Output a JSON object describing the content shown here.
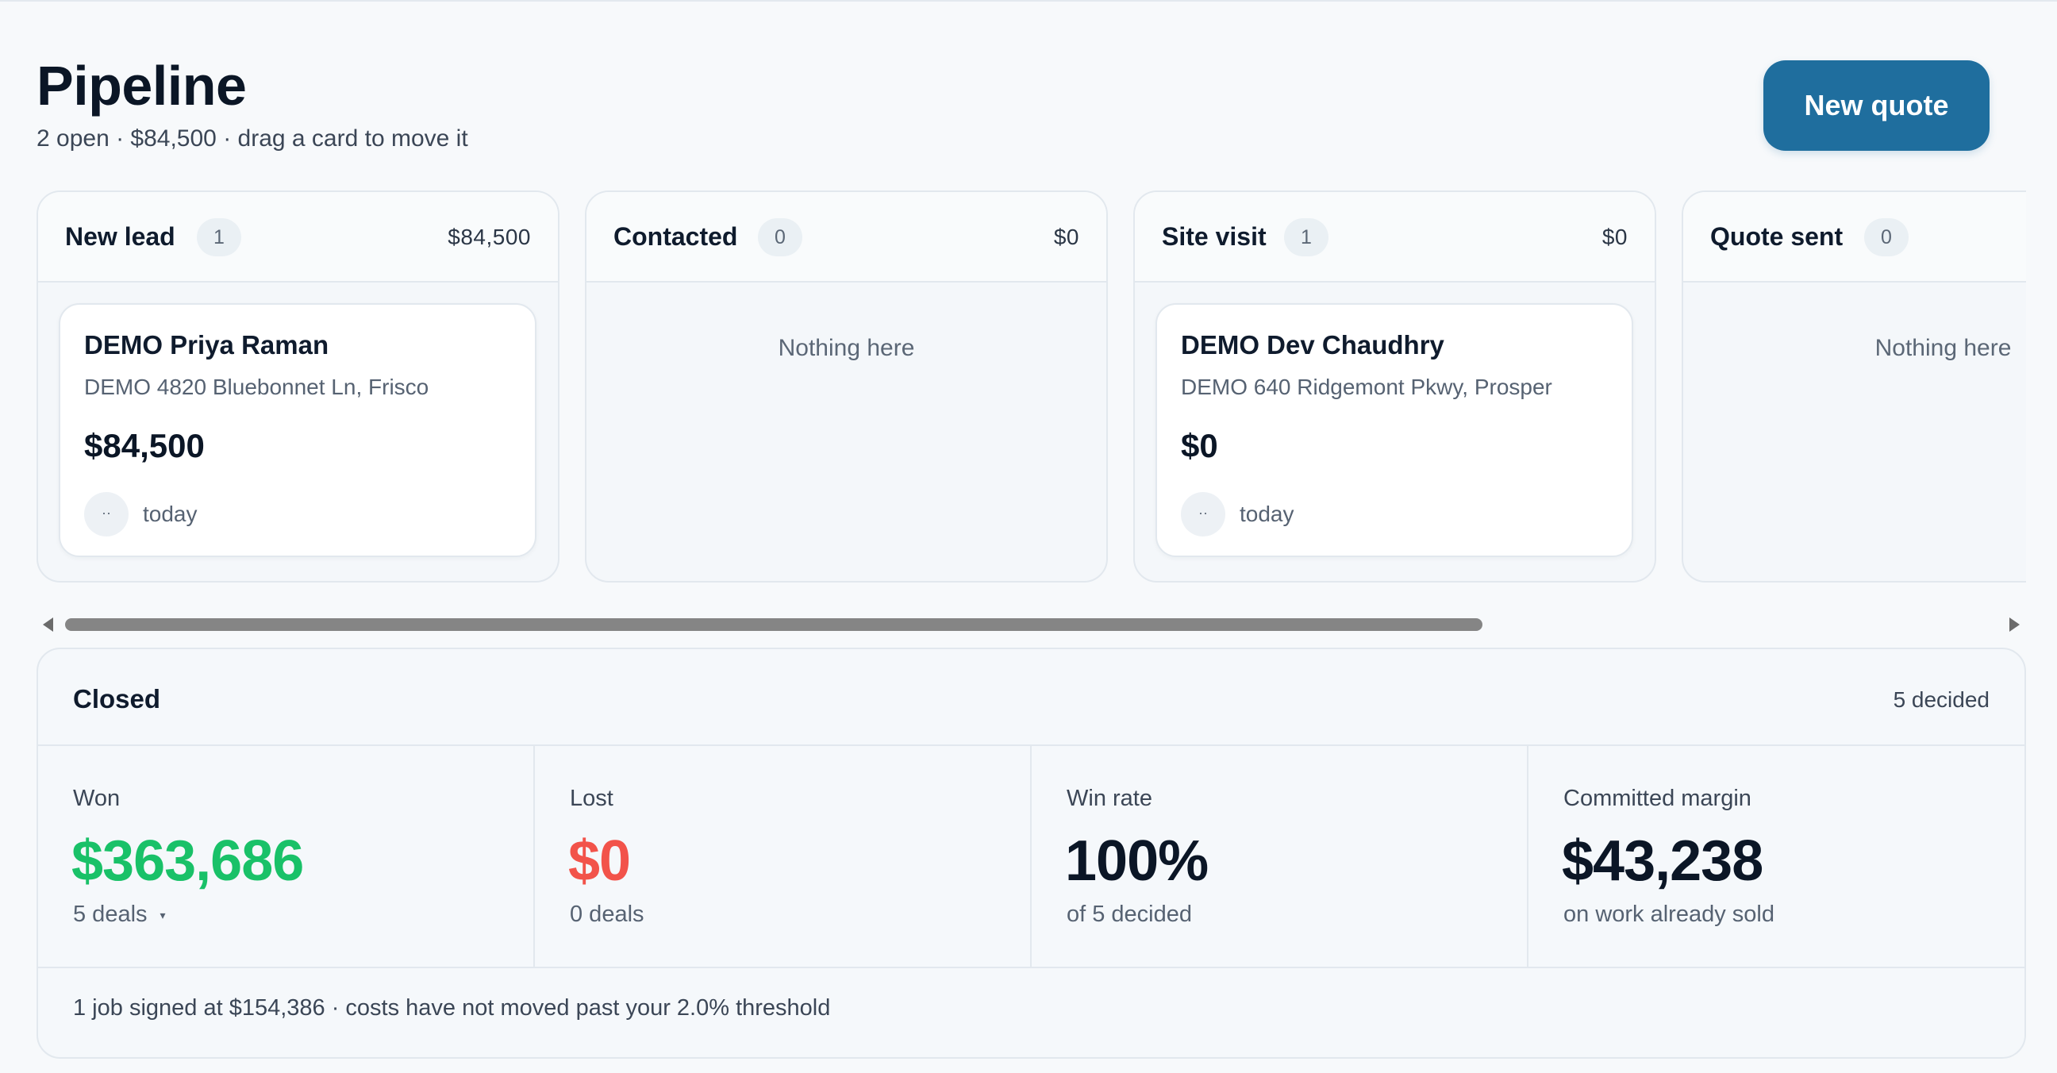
{
  "header": {
    "title": "Pipeline",
    "subtitle": "2 open · $84,500 · drag a card to move it",
    "new_quote_label": "New quote"
  },
  "colors": {
    "primary": "#1f6e9e",
    "won": "#19c168",
    "lost": "#f2534a"
  },
  "columns": [
    {
      "title": "New lead",
      "count": "1",
      "total": "$84,500",
      "card": {
        "name": "DEMO Priya Raman",
        "address": "DEMO 4820 Bluebonnet Ln, Frisco",
        "amount": "$84,500",
        "avatar": "··",
        "date": "today"
      }
    },
    {
      "title": "Contacted",
      "count": "0",
      "total": "$0",
      "empty": "Nothing here"
    },
    {
      "title": "Site visit",
      "count": "1",
      "total": "$0",
      "card": {
        "name": "DEMO Dev Chaudhry",
        "address": "DEMO 640 Ridgemont Pkwy, Prosper",
        "amount": "$0",
        "avatar": "··",
        "date": "today"
      }
    },
    {
      "title": "Quote sent",
      "count": "0",
      "empty": "Nothing here"
    }
  ],
  "closed": {
    "title": "Closed",
    "decided": "5 decided",
    "stats": [
      {
        "label": "Won",
        "value": "$363,686",
        "sub": "5 deals"
      },
      {
        "label": "Lost",
        "value": "$0",
        "sub": "0 deals"
      },
      {
        "label": "Win rate",
        "value": "100%",
        "sub": "of 5 decided"
      },
      {
        "label": "Committed margin",
        "value": "$43,238",
        "sub": "on work already sold"
      }
    ],
    "footer": "1 job signed at $154,386 · costs have not moved past your 2.0% threshold"
  }
}
